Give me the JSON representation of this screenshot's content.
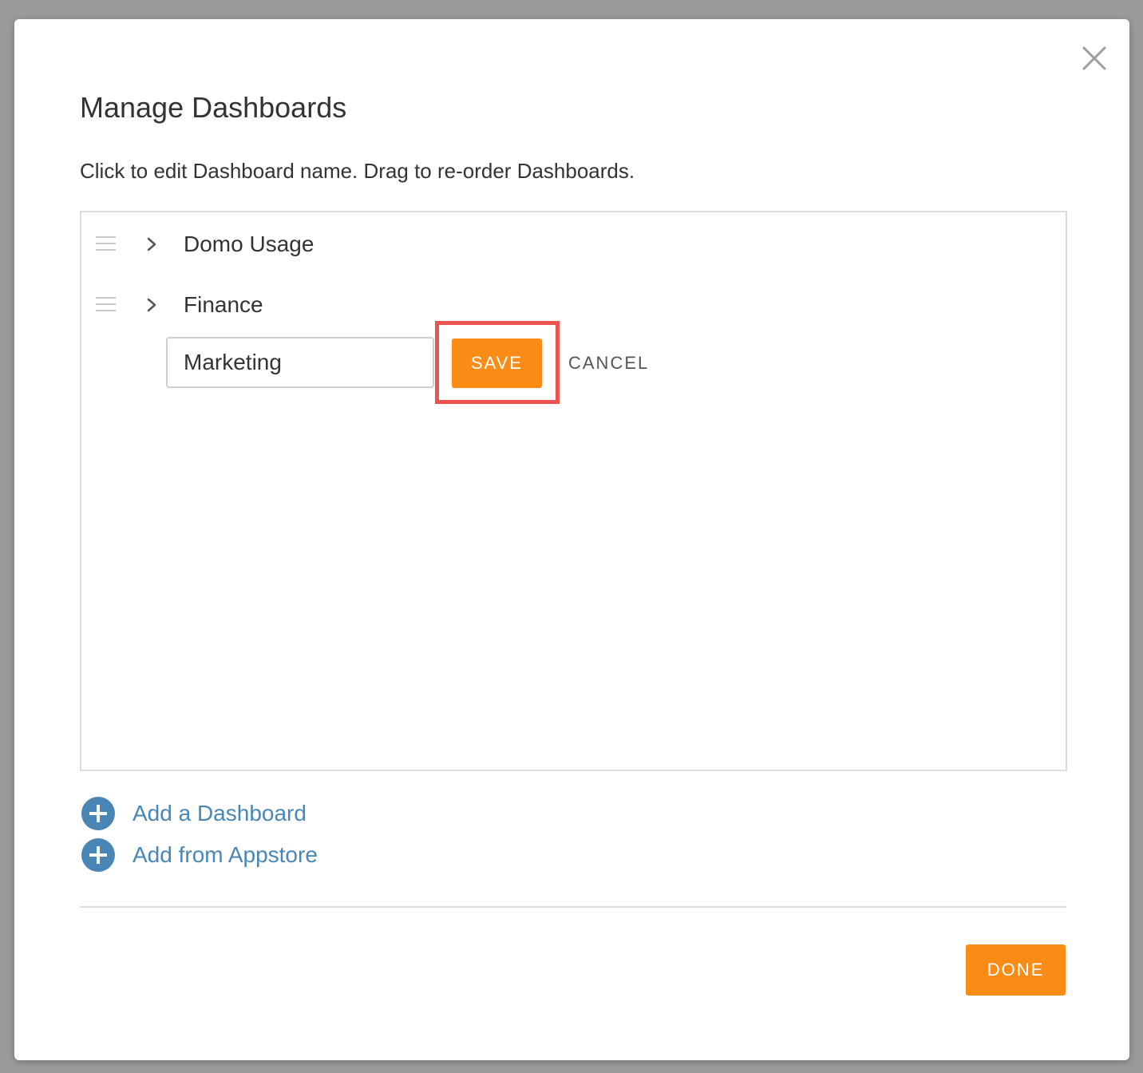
{
  "modal": {
    "title": "Manage Dashboards",
    "instructions": "Click to edit Dashboard name. Drag to re-order Dashboards.",
    "close_icon": "close-icon"
  },
  "dashboards": [
    {
      "label": "Domo Usage",
      "expand_icon": "chevron-right-icon",
      "drag_icon": "drag-handle-icon"
    },
    {
      "label": "Finance",
      "expand_icon": "chevron-right-icon",
      "drag_icon": "drag-handle-icon"
    }
  ],
  "edit_row": {
    "input_value": "Marketing",
    "save_label": "SAVE",
    "cancel_label": "CANCEL"
  },
  "actions": {
    "add_dashboard_label": "Add a Dashboard",
    "add_appstore_label": "Add from Appstore",
    "add_icon": "plus-circle-icon"
  },
  "footer": {
    "done_label": "DONE"
  },
  "colors": {
    "accent": "#fa8c16",
    "link": "#4a86b5",
    "highlight": "#ef5350",
    "text": "#333333"
  }
}
